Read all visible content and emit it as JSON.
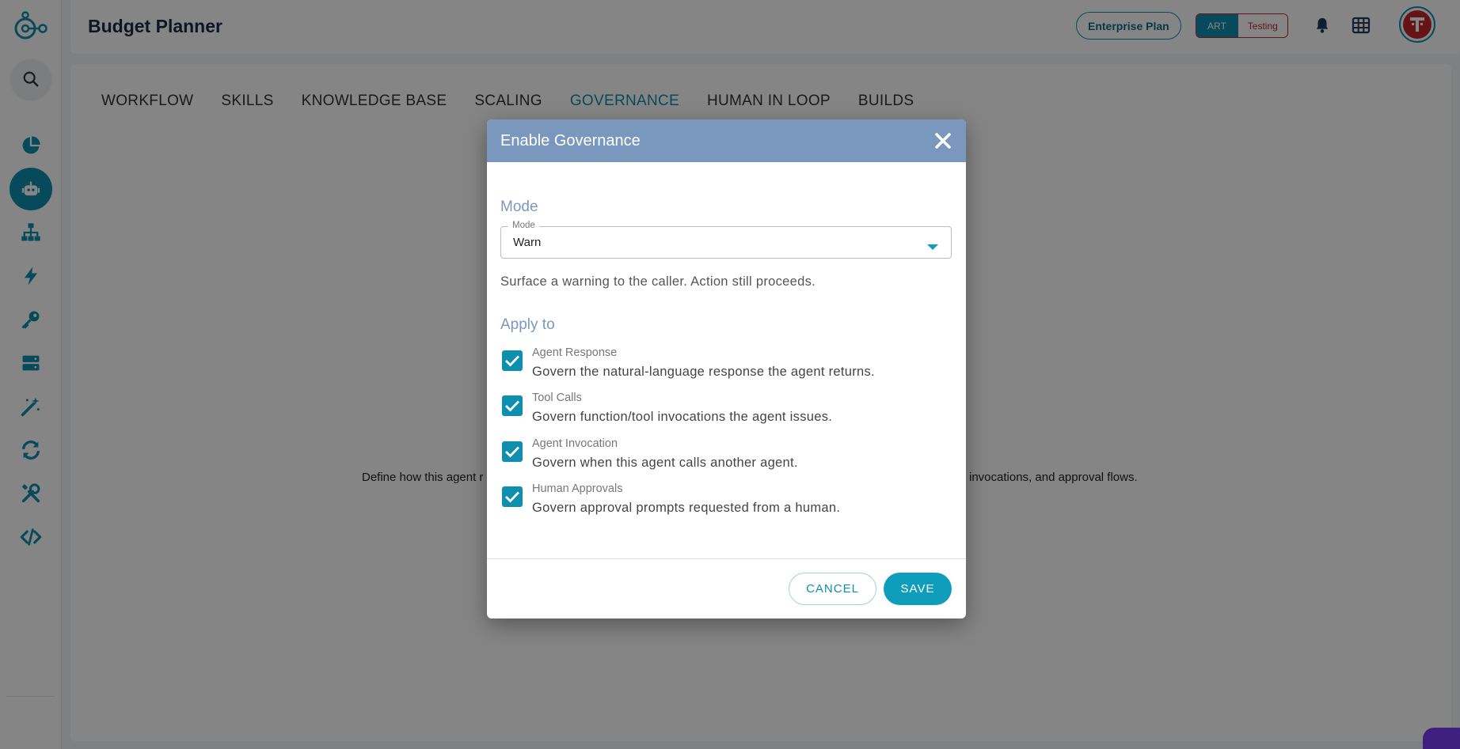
{
  "app": {
    "title": "Budget Planner",
    "plan_badge": "Enterprise Plan",
    "env_toggle": {
      "art": "ART",
      "testing": "Testing"
    }
  },
  "sidebar": {
    "items": [
      {
        "icon": "pie-chart-icon"
      },
      {
        "icon": "robot-icon",
        "active": true
      },
      {
        "icon": "hierarchy-icon"
      },
      {
        "icon": "lightning-icon"
      },
      {
        "icon": "key-icon"
      },
      {
        "icon": "server-icon"
      },
      {
        "icon": "magic-wand-icon"
      },
      {
        "icon": "sync-icon"
      },
      {
        "icon": "tools-icon"
      },
      {
        "icon": "code-icon"
      }
    ]
  },
  "tabs": [
    {
      "label": "WORKFLOW"
    },
    {
      "label": "SKILLS"
    },
    {
      "label": "KNOWLEDGE BASE"
    },
    {
      "label": "SCALING"
    },
    {
      "label": "GOVERNANCE",
      "active": true
    },
    {
      "label": "HUMAN IN LOOP"
    },
    {
      "label": "BUILDS"
    }
  ],
  "content": {
    "description_left": "Define how this agent r",
    "description_right": "invocations, and approval flows."
  },
  "modal": {
    "title": "Enable Governance",
    "mode_section": "Mode",
    "mode_field_label": "Mode",
    "mode_value": "Warn",
    "mode_description": "Surface a warning to the caller. Action still proceeds.",
    "apply_section": "Apply to",
    "options": [
      {
        "label": "Agent Response",
        "description": "Govern the natural-language response the agent returns.",
        "checked": true
      },
      {
        "label": "Tool Calls",
        "description": "Govern function/tool invocations the agent issues.",
        "checked": true
      },
      {
        "label": "Agent Invocation",
        "description": "Govern when this agent calls another agent.",
        "checked": true
      },
      {
        "label": "Human Approvals",
        "description": "Govern approval prompts requested from a human.",
        "checked": true
      }
    ],
    "cancel_label": "CANCEL",
    "save_label": "SAVE"
  },
  "colors": {
    "accent": "#0e8fae",
    "modal_header": "#7a98bd",
    "testing_red": "#c2262c"
  }
}
